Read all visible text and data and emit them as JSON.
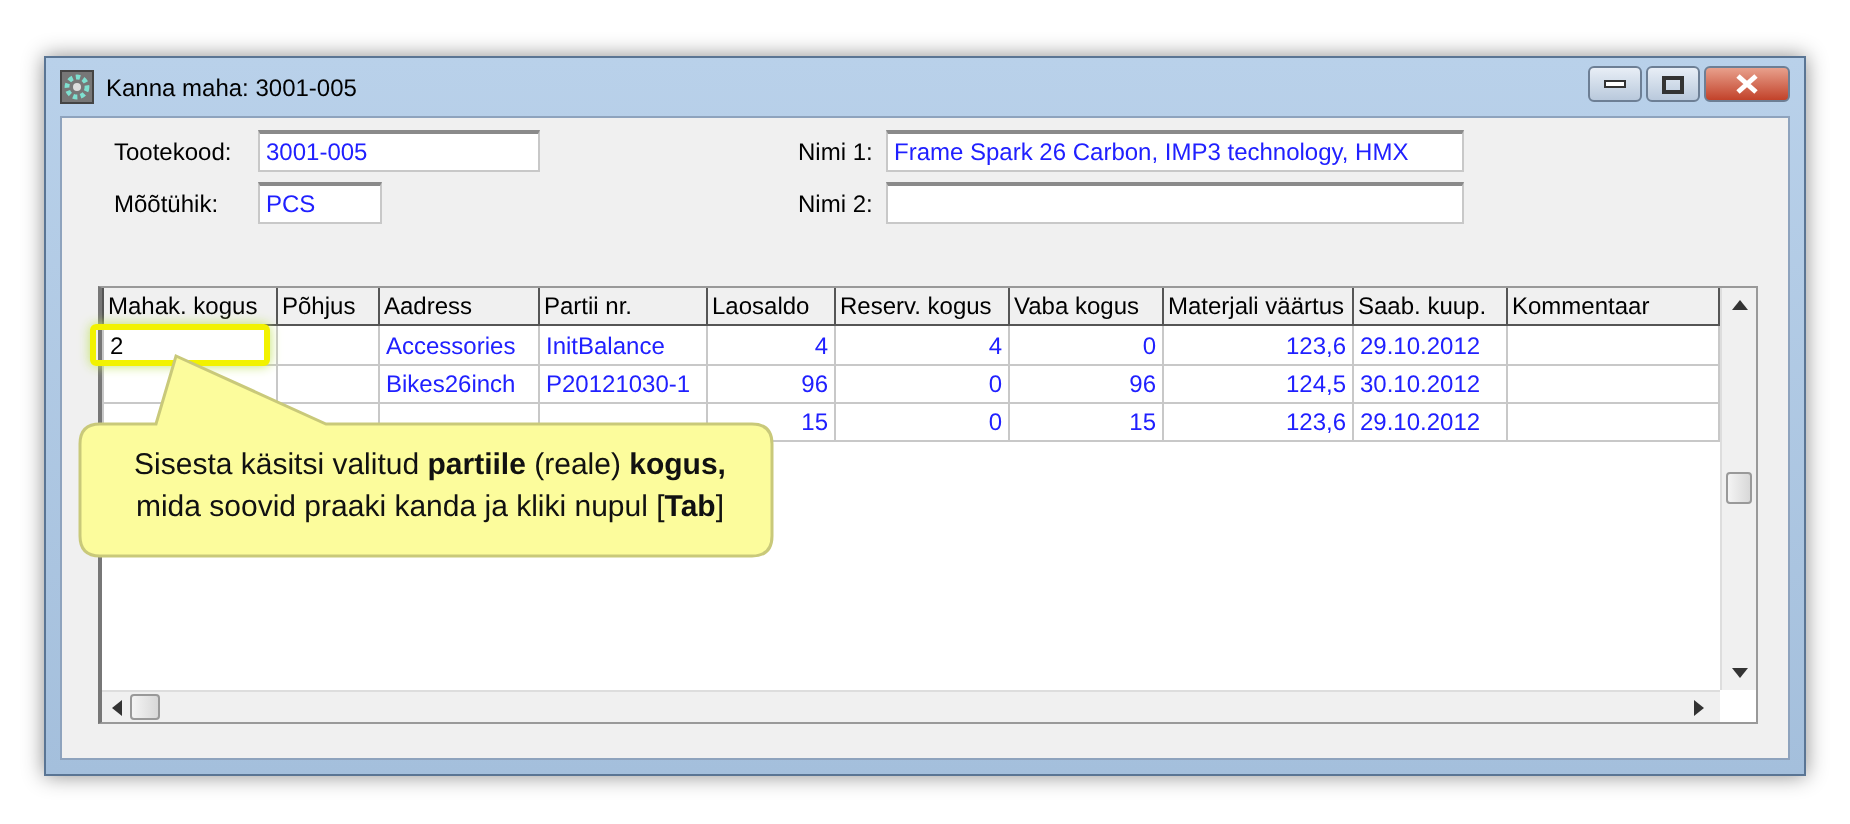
{
  "window": {
    "title": "Kanna maha: 3001-005"
  },
  "fields": [
    {
      "label": "Tootekood:",
      "value": "3001-005"
    },
    {
      "label": "Nimi 1:",
      "value": "Frame Spark 26 Carbon, IMP3 technology, HMX"
    },
    {
      "label": "Mõõtühik:",
      "value": "PCS"
    },
    {
      "label": "Nimi 2:"
    }
  ],
  "table": {
    "columns": [
      {
        "label": "Mahak. kogus"
      },
      {
        "label": "Põhjus"
      },
      {
        "label": "Aadress"
      },
      {
        "label": "Partii nr."
      },
      {
        "label": "Laosaldo"
      },
      {
        "label": "Reserv. kogus"
      },
      {
        "label": "Vaba kogus"
      },
      {
        "label": "Materjali väärtus"
      },
      {
        "label": "Saab. kuup."
      },
      {
        "label": "Kommentaar"
      }
    ],
    "rows": [
      {
        "cells": [
          "2",
          "",
          "Accessories",
          "InitBalance",
          "4",
          "4",
          "0",
          "123,6",
          "29.10.2012",
          ""
        ]
      },
      {
        "cells": [
          "",
          "",
          "Bikes26inch",
          "P20121030-1",
          "96",
          "0",
          "96",
          "124,5",
          "30.10.2012",
          ""
        ]
      },
      {
        "cells": [
          "",
          "",
          "",
          "",
          "15",
          "0",
          "15",
          "123,6",
          "29.10.2012",
          ""
        ]
      }
    ]
  },
  "callout": {
    "lines": [
      "Sisesta käsitsi valitud **partiile** (reale) **kogus,**",
      "mida soovid praaki kanda ja kliki nupul [**Tab**]"
    ]
  }
}
